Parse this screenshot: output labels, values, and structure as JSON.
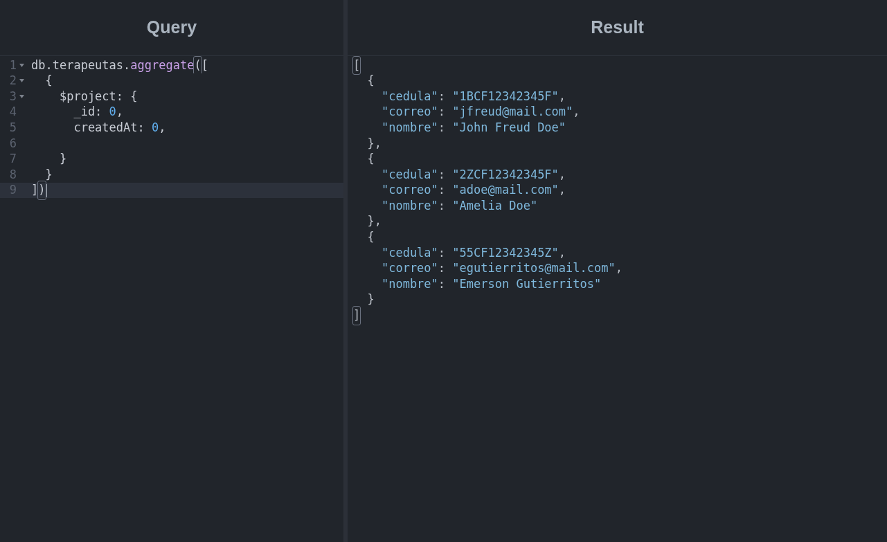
{
  "panes": [
    {
      "title": "Query",
      "kind": "editor",
      "lines": [
        {
          "number": "1",
          "fold": true,
          "active": false,
          "cursor": false,
          "tokens": [
            {
              "text": "db.terapeutas.",
              "kind": "plain",
              "matched": false
            },
            {
              "text": "aggregate",
              "kind": "method",
              "matched": false
            },
            {
              "text": "(",
              "kind": "plain",
              "matched": true
            },
            {
              "text": "[",
              "kind": "plain",
              "matched": false
            }
          ]
        },
        {
          "number": "2",
          "fold": true,
          "active": false,
          "cursor": false,
          "tokens": [
            {
              "text": "  {",
              "kind": "plain",
              "matched": false
            }
          ]
        },
        {
          "number": "3",
          "fold": true,
          "active": false,
          "cursor": false,
          "tokens": [
            {
              "text": "    $project: {",
              "kind": "plain",
              "matched": false
            }
          ]
        },
        {
          "number": "4",
          "fold": false,
          "active": false,
          "cursor": false,
          "tokens": [
            {
              "text": "      _id: ",
              "kind": "plain",
              "matched": false
            },
            {
              "text": "0",
              "kind": "number",
              "matched": false
            },
            {
              "text": ",",
              "kind": "plain",
              "matched": false
            }
          ]
        },
        {
          "number": "5",
          "fold": false,
          "active": false,
          "cursor": false,
          "tokens": [
            {
              "text": "      createdAt: ",
              "kind": "plain",
              "matched": false
            },
            {
              "text": "0",
              "kind": "number",
              "matched": false
            },
            {
              "text": ",",
              "kind": "plain",
              "matched": false
            }
          ]
        },
        {
          "number": "6",
          "fold": false,
          "active": false,
          "cursor": false
        },
        {
          "number": "7",
          "fold": false,
          "active": false,
          "cursor": false,
          "tokens": [
            {
              "text": "    }",
              "kind": "plain",
              "matched": false
            }
          ]
        },
        {
          "number": "8",
          "fold": false,
          "active": false,
          "cursor": false,
          "tokens": [
            {
              "text": "  }",
              "kind": "plain",
              "matched": false
            }
          ]
        },
        {
          "number": "9",
          "fold": false,
          "active": true,
          "cursor": true,
          "tokens": [
            {
              "text": "]",
              "kind": "plain",
              "matched": false
            },
            {
              "text": ")",
              "kind": "plain",
              "matched": true
            }
          ]
        }
      ]
    },
    {
      "title": "Result",
      "kind": "output",
      "lines": [
        {
          "tokens": [
            {
              "text": "[",
              "kind": "punct",
              "matched": true
            }
          ]
        },
        {
          "tokens": [
            {
              "text": "  {",
              "kind": "punct",
              "matched": false
            }
          ]
        },
        {
          "tokens": [
            {
              "text": "    \"cedula\"",
              "kind": "key",
              "matched": false
            },
            {
              "text": ": ",
              "kind": "punct",
              "matched": false
            },
            {
              "text": "\"1BCF12342345F\"",
              "kind": "string",
              "matched": false
            },
            {
              "text": ",",
              "kind": "punct",
              "matched": false
            }
          ]
        },
        {
          "tokens": [
            {
              "text": "    \"correo\"",
              "kind": "key",
              "matched": false
            },
            {
              "text": ": ",
              "kind": "punct",
              "matched": false
            },
            {
              "text": "\"jfreud@mail.com\"",
              "kind": "string",
              "matched": false
            },
            {
              "text": ",",
              "kind": "punct",
              "matched": false
            }
          ]
        },
        {
          "tokens": [
            {
              "text": "    \"nombre\"",
              "kind": "key",
              "matched": false
            },
            {
              "text": ": ",
              "kind": "punct",
              "matched": false
            },
            {
              "text": "\"John Freud Doe\"",
              "kind": "string",
              "matched": false
            }
          ]
        },
        {
          "tokens": [
            {
              "text": "  },",
              "kind": "punct",
              "matched": false
            }
          ]
        },
        {
          "tokens": [
            {
              "text": "  {",
              "kind": "punct",
              "matched": false
            }
          ]
        },
        {
          "tokens": [
            {
              "text": "    \"cedula\"",
              "kind": "key",
              "matched": false
            },
            {
              "text": ": ",
              "kind": "punct",
              "matched": false
            },
            {
              "text": "\"2ZCF12342345F\"",
              "kind": "string",
              "matched": false
            },
            {
              "text": ",",
              "kind": "punct",
              "matched": false
            }
          ]
        },
        {
          "tokens": [
            {
              "text": "    \"correo\"",
              "kind": "key",
              "matched": false
            },
            {
              "text": ": ",
              "kind": "punct",
              "matched": false
            },
            {
              "text": "\"adoe@mail.com\"",
              "kind": "string",
              "matched": false
            },
            {
              "text": ",",
              "kind": "punct",
              "matched": false
            }
          ]
        },
        {
          "tokens": [
            {
              "text": "    \"nombre\"",
              "kind": "key",
              "matched": false
            },
            {
              "text": ": ",
              "kind": "punct",
              "matched": false
            },
            {
              "text": "\"Amelia Doe\"",
              "kind": "string",
              "matched": false
            }
          ]
        },
        {
          "tokens": [
            {
              "text": "  },",
              "kind": "punct",
              "matched": false
            }
          ]
        },
        {
          "tokens": [
            {
              "text": "  {",
              "kind": "punct",
              "matched": false
            }
          ]
        },
        {
          "tokens": [
            {
              "text": "    \"cedula\"",
              "kind": "key",
              "matched": false
            },
            {
              "text": ": ",
              "kind": "punct",
              "matched": false
            },
            {
              "text": "\"55CF12342345Z\"",
              "kind": "string",
              "matched": false
            },
            {
              "text": ",",
              "kind": "punct",
              "matched": false
            }
          ]
        },
        {
          "tokens": [
            {
              "text": "    \"correo\"",
              "kind": "key",
              "matched": false
            },
            {
              "text": ": ",
              "kind": "punct",
              "matched": false
            },
            {
              "text": "\"egutierritos@mail.com\"",
              "kind": "string",
              "matched": false
            },
            {
              "text": ",",
              "kind": "punct",
              "matched": false
            }
          ]
        },
        {
          "tokens": [
            {
              "text": "    \"nombre\"",
              "kind": "key",
              "matched": false
            },
            {
              "text": ": ",
              "kind": "punct",
              "matched": false
            },
            {
              "text": "\"Emerson Gutierritos\"",
              "kind": "string",
              "matched": false
            }
          ]
        },
        {
          "tokens": [
            {
              "text": "  }",
              "kind": "punct",
              "matched": false
            }
          ]
        },
        {
          "tokens": [
            {
              "text": "]",
              "kind": "punct",
              "matched": true
            }
          ]
        }
      ]
    }
  ]
}
